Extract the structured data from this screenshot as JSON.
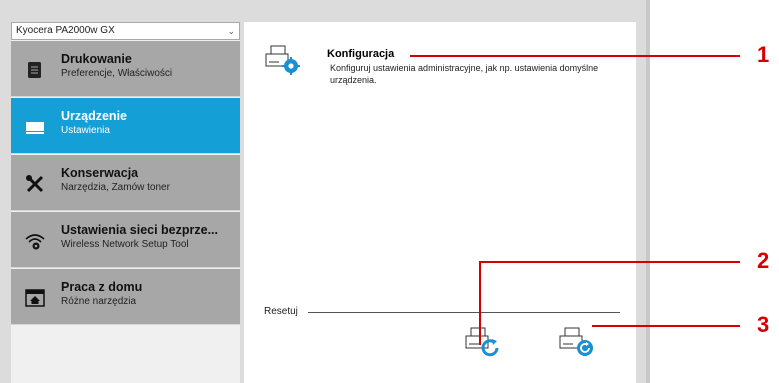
{
  "window": {
    "model": "Kyocera PA2000w GX"
  },
  "sidebar": {
    "items": [
      {
        "title": "Drukowanie",
        "subtitle": "Preferencje, Właściwości",
        "icon": "document-icon"
      },
      {
        "title": "Urządzenie",
        "subtitle": "Ustawienia",
        "icon": "printer-icon"
      },
      {
        "title": "Konserwacja",
        "subtitle": "Narzędzia, Zamów toner",
        "icon": "tools-icon"
      },
      {
        "title": "Ustawienia sieci bezprze...",
        "subtitle": "Wireless Network Setup Tool",
        "icon": "wifi-gear-icon"
      },
      {
        "title": "Praca z domu",
        "subtitle": "Różne narzędzia",
        "icon": "home-icon"
      }
    ],
    "active_index": 1
  },
  "main": {
    "config_title": "Konfiguracja",
    "config_desc": "Konfiguruj ustawienia administracyjne, jak np. ustawienia domyślne urządzenia.",
    "reset_label": "Resetuj"
  },
  "callouts": [
    "1",
    "2",
    "3"
  ],
  "colors": {
    "accent": "#149fd7",
    "callout": "#d40000",
    "inactive": "#a7a7a7"
  }
}
